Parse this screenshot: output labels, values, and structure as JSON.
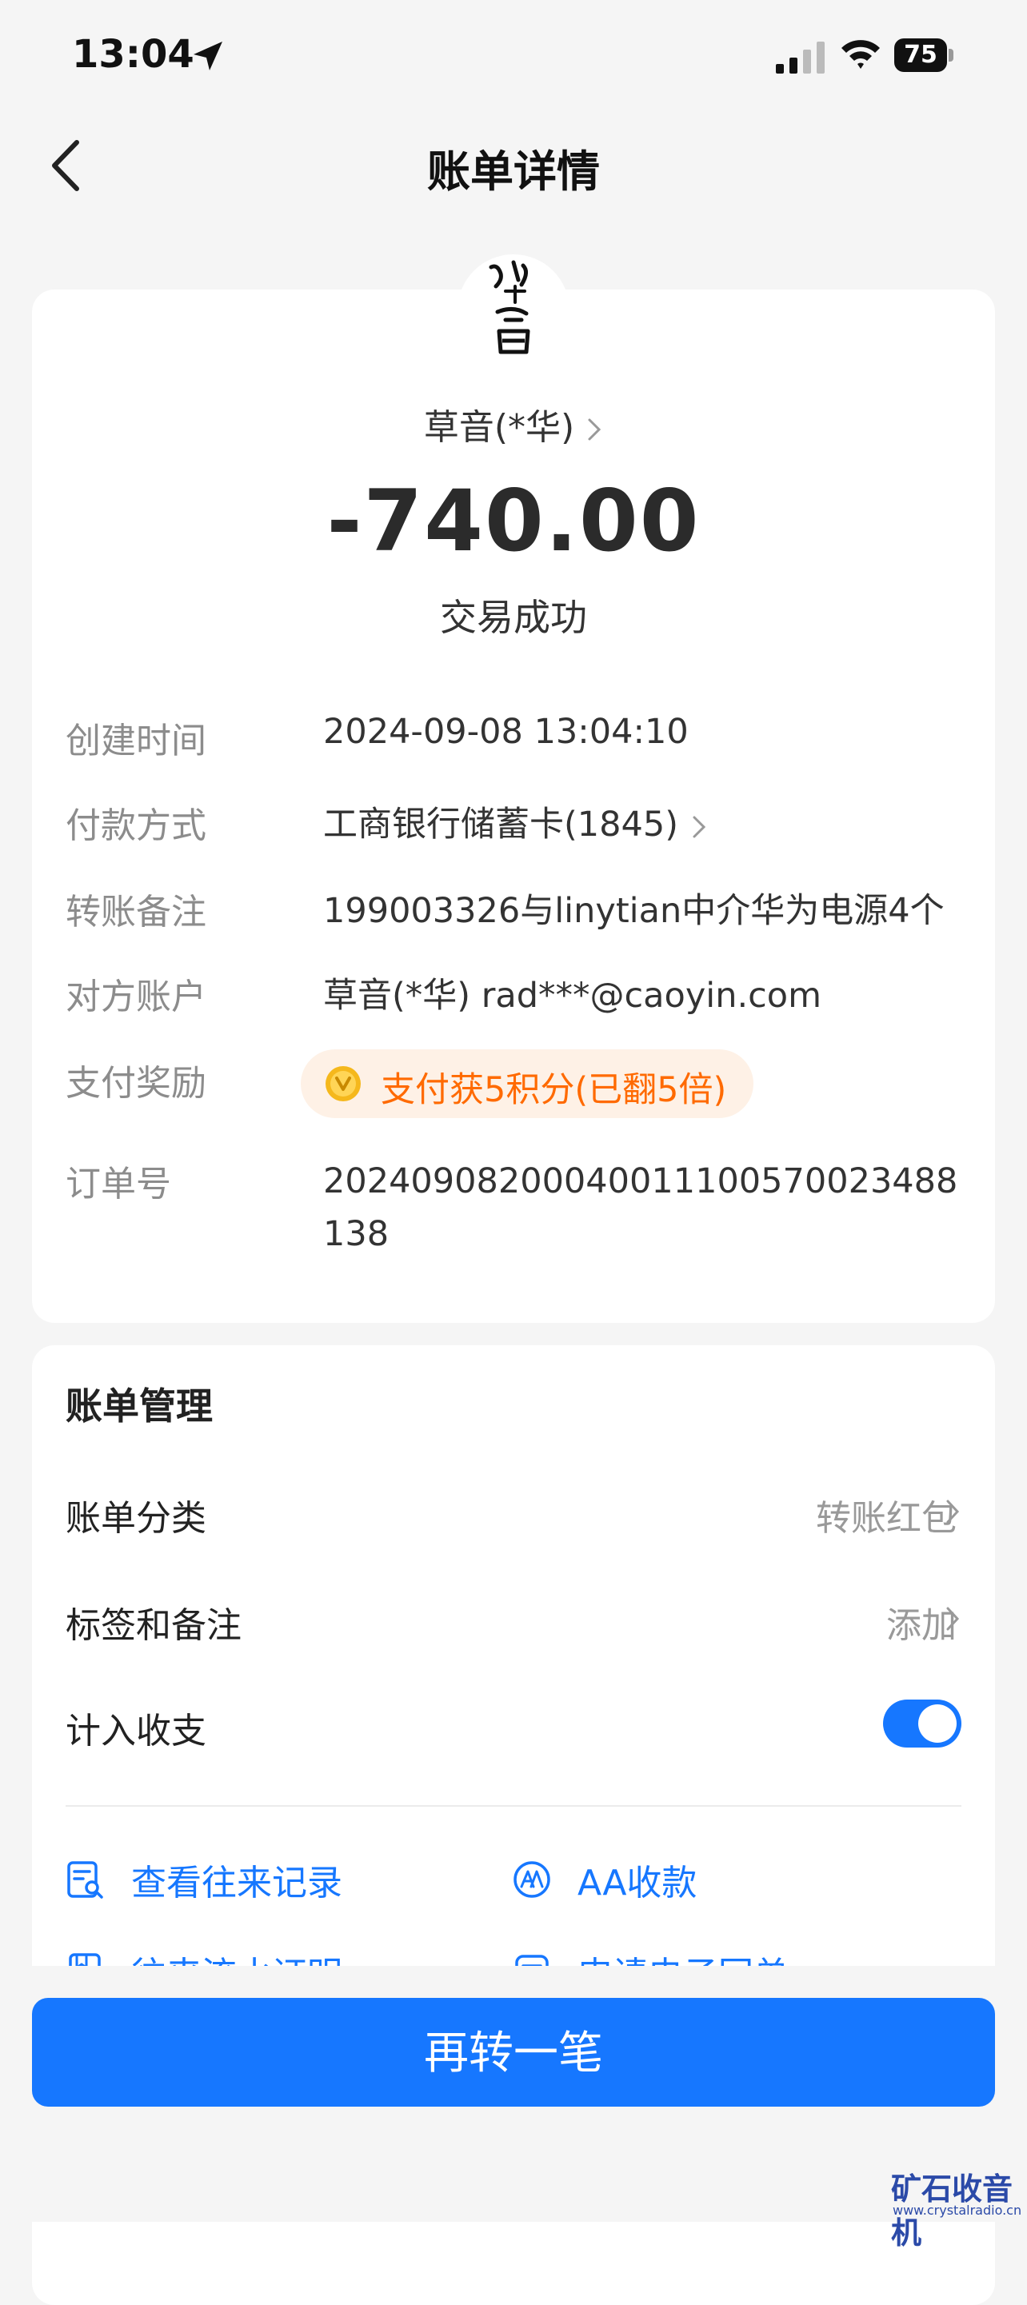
{
  "status_bar": {
    "time": "13:04",
    "battery": "75"
  },
  "nav": {
    "title": "账单详情"
  },
  "bill": {
    "payee": "草音(*华)",
    "amount": "-740.00",
    "status": "交易成功",
    "rows": [
      {
        "label": "创建时间",
        "value": "2024-09-08 13:04:10"
      },
      {
        "label": "付款方式",
        "value": "工商银行储蓄卡(1845)"
      },
      {
        "label": "转账备注",
        "value": "199003326与linytian中介华为电源4个"
      },
      {
        "label": "对方账户",
        "value": "草音(*华) rad***@caoyin.com"
      },
      {
        "label": "支付奖励",
        "value": "支付获5积分(已翻5倍)"
      },
      {
        "label": "订单号",
        "value": "20240908200040011100570023488138"
      }
    ]
  },
  "management": {
    "title": "账单管理",
    "category_label": "账单分类",
    "category_value": "转账红包",
    "tags_label": "标签和备注",
    "tags_value": "添加",
    "count_label": "计入收支",
    "count_enabled": true
  },
  "actions": [
    {
      "label": "查看往来记录",
      "icon": "history-record-icon"
    },
    {
      "label": "AA收款",
      "icon": "aa-collect-icon"
    },
    {
      "label": "往来流水证明",
      "icon": "statement-proof-icon"
    },
    {
      "label": "申请电子回单",
      "icon": "e-receipt-icon"
    }
  ],
  "footer": {
    "primary_button": "再转一笔"
  },
  "watermark": {
    "text": "矿石收音机",
    "url": "www.crystalradio.cn"
  },
  "colors": {
    "accent": "#1677FF",
    "reward": "#FF6A00",
    "background": "#F5F5F5"
  }
}
